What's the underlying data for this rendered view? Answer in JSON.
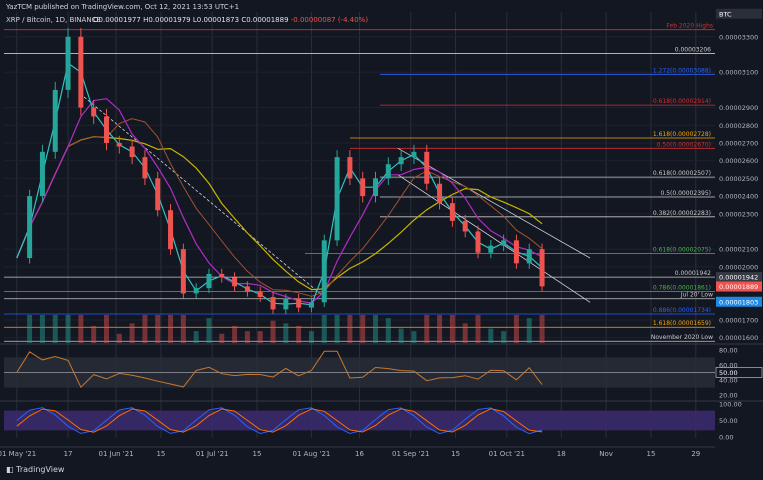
{
  "header": {
    "publisher_line": "YazTCM published on TradingView.com, Oct 12, 2021 13:53 UTC+1",
    "symbol_line": "XRP / Bitcoin, 1D, BINANCE",
    "ohlc": {
      "open": "O0.00001977",
      "high": "H0.00001979",
      "low": "L0.00001873",
      "close": "C0.00001889",
      "change": "-0.00000087 (-4.40%)"
    }
  },
  "footer": {
    "logo_text": "TradingView"
  },
  "colors": {
    "background": "#131722",
    "candle_up": "#26a69a",
    "candle_down": "#ef5350",
    "ma_fast": "#2ec4c4",
    "ma_mid": "#b22cc7",
    "ma_slow": "#a0522d",
    "ma_200": "#c8b400",
    "rsi_line": "#c8782a",
    "stoch_k": "#2962ff",
    "stoch_d": "#ff6d00",
    "stoch_band": "#3b2a6b"
  },
  "chart_data": {
    "type": "line",
    "title": "XRP / Bitcoin, 1D, BINANCE",
    "xlabel": "",
    "ylabel": "",
    "x_ticks": [
      "01 May '21",
      "17",
      "01 Jun '21",
      "15",
      "01 Jul '21",
      "15",
      "01 Aug '21",
      "16",
      "01 Sep '21",
      "15",
      "01 Oct '21",
      "18",
      "Nov",
      "15",
      "29"
    ],
    "y_ticks": [
      "0.00003300",
      "0.00003100",
      "0.00002900",
      "0.00002800",
      "0.00002700",
      "0.00002600",
      "0.00002500",
      "0.00002400",
      "0.00002300",
      "0.00002100",
      "0.00002000",
      "0.00001700",
      "0.00001600"
    ],
    "ylim": [
      1.57e-05,
      3.44e-05
    ],
    "price_series": {
      "name": "XRP/BTC close",
      "x": [
        "2021-05-01",
        "2021-05-05",
        "2021-05-09",
        "2021-05-13",
        "2021-05-17",
        "2021-05-21",
        "2021-05-25",
        "2021-05-29",
        "2021-06-02",
        "2021-06-06",
        "2021-06-10",
        "2021-06-14",
        "2021-06-18",
        "2021-06-22",
        "2021-06-26",
        "2021-06-30",
        "2021-07-04",
        "2021-07-08",
        "2021-07-12",
        "2021-07-16",
        "2021-07-20",
        "2021-07-24",
        "2021-07-28",
        "2021-08-01",
        "2021-08-05",
        "2021-08-09",
        "2021-08-13",
        "2021-08-17",
        "2021-08-21",
        "2021-08-25",
        "2021-08-29",
        "2021-09-02",
        "2021-09-06",
        "2021-09-10",
        "2021-09-14",
        "2021-09-18",
        "2021-09-22",
        "2021-09-26",
        "2021-09-30",
        "2021-10-04",
        "2021-10-08",
        "2021-10-12"
      ],
      "y": [
        2.05e-05,
        2.4e-05,
        2.65e-05,
        3e-05,
        3.3e-05,
        2.9e-05,
        2.85e-05,
        2.7e-05,
        2.68e-05,
        2.62e-05,
        2.5e-05,
        2.32e-05,
        2.1e-05,
        1.85e-05,
        1.88e-05,
        1.96e-05,
        1.94e-05,
        1.89e-05,
        1.86e-05,
        1.83e-05,
        1.76e-05,
        1.82e-05,
        1.77e-05,
        1.8e-05,
        2.15e-05,
        2.62e-05,
        2.5e-05,
        2.4e-05,
        2.5e-05,
        2.58e-05,
        2.62e-05,
        2.65e-05,
        2.47e-05,
        2.36e-05,
        2.26e-05,
        2.2e-05,
        2.08e-05,
        2.12e-05,
        2.15e-05,
        2.02e-05,
        2.1e-05,
        1.89e-05
      ]
    },
    "fib_levels": [
      {
        "label": "Feb 2020 Highs",
        "value": 3.34e-05
      },
      {
        "label": "0.00003206",
        "value": 3.206e-05
      },
      {
        "label": "1.272(0.00003088)",
        "value": 3.088e-05
      },
      {
        "label": "0.618(0.00002914)",
        "value": 2.914e-05
      },
      {
        "label": "1.618(0.00002728)",
        "value": 2.728e-05
      },
      {
        "label": "0.50(0.00002670)",
        "value": 2.67e-05
      },
      {
        "label": "0.618(0.00002507)",
        "value": 2.507e-05
      },
      {
        "label": "0.5(0.00002395)",
        "value": 2.395e-05
      },
      {
        "label": "0.382(0.00002283)",
        "value": 2.283e-05
      },
      {
        "label": "0.618(0.00002075)",
        "value": 2.075e-05
      },
      {
        "label": "0.00001942",
        "value": 1.942e-05
      },
      {
        "label": "0.786(0.00001861)",
        "value": 1.861e-05
      },
      {
        "label": "Jul 20' Low",
        "value": 1.82e-05
      },
      {
        "label": "0.886(0.00001734)",
        "value": 1.734e-05
      },
      {
        "label": "1.618(0.00001659)",
        "value": 1.659e-05
      },
      {
        "label": "November 2020 Low",
        "value": 1.58e-05
      }
    ],
    "price_tags": [
      {
        "label": "0.00001942",
        "value": 1.942e-05
      },
      {
        "label": "0.00001889",
        "value": 1.889e-05
      },
      {
        "label": "0.00001803",
        "value": 1.803e-05
      },
      {
        "label": "BTC",
        "value": 3.43e-05
      }
    ],
    "rsi": {
      "ticks": [
        "80.00",
        "60.00",
        "40.00",
        "20.00"
      ],
      "marker": "50.00",
      "ylim": [
        15,
        85
      ]
    },
    "stoch": {
      "ticks": [
        "100.00",
        "50.00",
        "0.00"
      ],
      "ylim": [
        0,
        100
      ]
    }
  }
}
